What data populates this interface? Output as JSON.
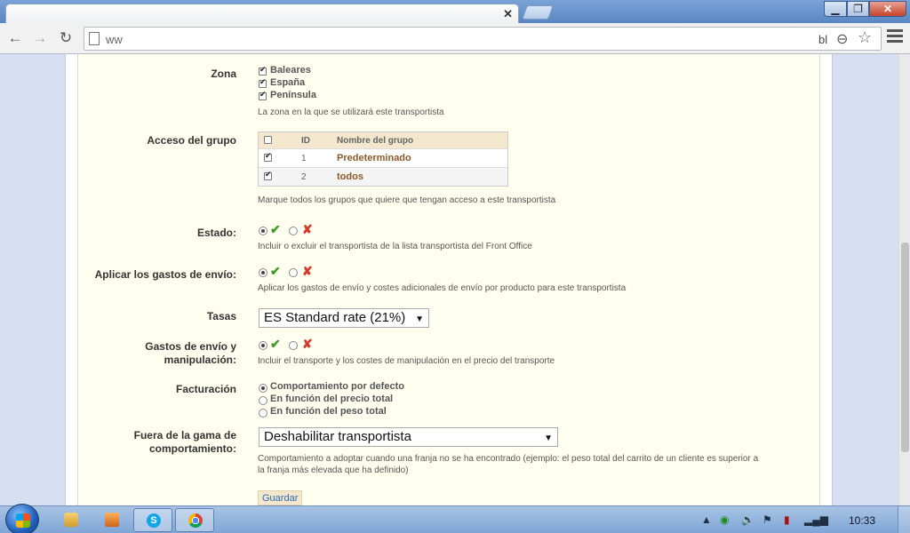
{
  "browser": {
    "url_visible_start": "ww",
    "url_visible_end": "bl",
    "tab_close_glyph": "✕",
    "menu_icon": "hamburger-menu-icon"
  },
  "window_controls": {
    "minimize": "▁",
    "maximize": "❐",
    "close": "✕"
  },
  "form": {
    "zone": {
      "label": "Zona",
      "options": [
        {
          "label": "Baleares",
          "checked": true
        },
        {
          "label": "España",
          "checked": true
        },
        {
          "label": "Península",
          "checked": true
        }
      ],
      "help": "La zona en la que se utilizará este transportista"
    },
    "group_access": {
      "label": "Acceso del grupo",
      "columns": {
        "id": "ID",
        "name": "Nombre del grupo"
      },
      "rows": [
        {
          "id": "1",
          "name": "Predeterminado",
          "checked": true
        },
        {
          "id": "2",
          "name": "todos",
          "checked": true
        }
      ],
      "help": "Marque todos los grupos que quiere que tengan acceso a este transportista"
    },
    "status": {
      "label": "Estado:",
      "selected": "yes",
      "help": "Incluir o excluir el transportista de la lista transportista del Front Office"
    },
    "shipping_costs": {
      "label": "Aplicar los gastos de envío:",
      "selected": "yes",
      "help": "Aplicar los gastos de envío y costes adicionales de envío por producto para este transportista"
    },
    "taxes": {
      "label": "Tasas",
      "value": "ES Standard rate (21%)"
    },
    "handling": {
      "label_line1": "Gastos de envío y",
      "label_line2": "manipulación:",
      "selected": "yes",
      "help": "Incluir el transporte y los costes de manipulación en el precio del transporte"
    },
    "billing": {
      "label": "Facturación",
      "options": [
        {
          "label": "Comportamiento por defecto",
          "selected": true
        },
        {
          "label": "En función del precio total",
          "selected": false
        },
        {
          "label": "En función del peso total",
          "selected": false
        }
      ]
    },
    "out_of_range": {
      "label_line1": "Fuera de la gama de",
      "label_line2": "comportamiento:",
      "value": "Deshabilitar transportista",
      "help_line1": "Comportamiento a adoptar cuando una franja no se ha encontrado (ejemplo: el peso total del carrito de un cliente es superior a",
      "help_line2": "la franja más elevada que ha definido)"
    },
    "save_label": "Guardar"
  },
  "taskbar": {
    "clock": "10:33",
    "skype_glyph": "S"
  }
}
